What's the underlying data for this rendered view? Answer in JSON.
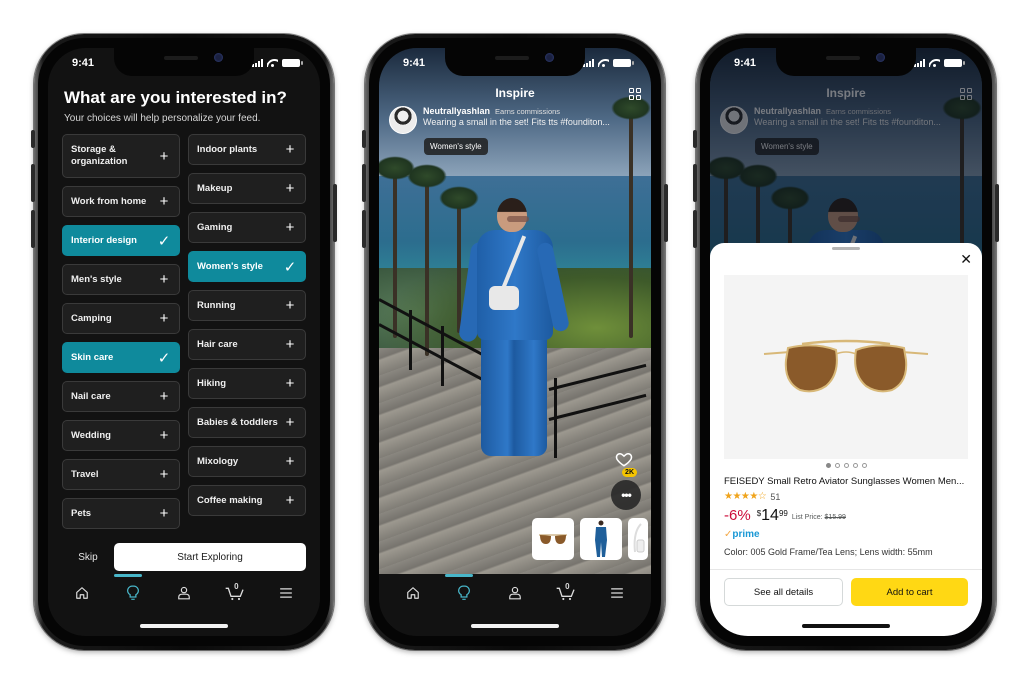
{
  "status_bar": {
    "time": "9:41"
  },
  "colors": {
    "accent_teal": "#0f8a9c",
    "nav_active": "#48b6c9",
    "add_to_cart": "#ffd814",
    "discount_red": "#cc0c39",
    "prime_blue": "#1a98d5",
    "like_badge": "#f5c400"
  },
  "nav": {
    "items": [
      {
        "name": "home",
        "icon": "home-icon",
        "active": false
      },
      {
        "name": "inspire",
        "icon": "lightbulb-icon",
        "active": true
      },
      {
        "name": "account",
        "icon": "person-icon",
        "active": false
      },
      {
        "name": "cart",
        "icon": "cart-icon",
        "active": false,
        "count": "0"
      },
      {
        "name": "menu",
        "icon": "hamburger-menu-icon",
        "active": false
      }
    ]
  },
  "onboarding": {
    "title": "What are you interested in?",
    "subtitle": "Your choices will help personalize your feed.",
    "left_column": [
      {
        "label": "Storage & organization",
        "selected": false
      },
      {
        "label": "Work from home",
        "selected": false
      },
      {
        "label": "Interior design",
        "selected": true
      },
      {
        "label": "Men's style",
        "selected": false
      },
      {
        "label": "Camping",
        "selected": false
      },
      {
        "label": "Skin care",
        "selected": true
      },
      {
        "label": "Nail care",
        "selected": false
      },
      {
        "label": "Wedding",
        "selected": false
      },
      {
        "label": "Travel",
        "selected": false
      },
      {
        "label": "Pets",
        "selected": false
      }
    ],
    "right_column": [
      {
        "label": "Indoor plants",
        "selected": false
      },
      {
        "label": "Makeup",
        "selected": false
      },
      {
        "label": "Gaming",
        "selected": false
      },
      {
        "label": "Women's style",
        "selected": true
      },
      {
        "label": "Running",
        "selected": false
      },
      {
        "label": "Hair care",
        "selected": false
      },
      {
        "label": "Hiking",
        "selected": false
      },
      {
        "label": "Babies & toddlers",
        "selected": false
      },
      {
        "label": "Mixology",
        "selected": false
      },
      {
        "label": "Coffee making",
        "selected": false
      }
    ],
    "skip_label": "Skip",
    "start_label": "Start Exploring"
  },
  "feed": {
    "title": "Inspire",
    "creator_name": "Neutrallyashlan",
    "earns_label": "Earns commissions",
    "caption": "Wearing a small in the set! Fits tts #founditon...",
    "style_tag": "Women's style",
    "like_count": "2K",
    "more_label": "•••",
    "thumbnails": [
      "sunglasses",
      "blue-jumpsuit",
      "white-bag"
    ]
  },
  "product": {
    "title": "FEISEDY Small Retro Aviator Sunglasses Women Men...",
    "rating": 4.5,
    "stars_display": "★★★★☆",
    "review_count": "51",
    "discount": "-6%",
    "price_symbol": "$",
    "price_whole": "14",
    "price_fraction": "99",
    "list_price_label": "List Price:",
    "list_price": "$15.99",
    "prime_check": "✓",
    "prime_label": "prime",
    "color_info": "Color: 005 Gold Frame/Tea Lens; Lens width: 55mm",
    "image_count": 5,
    "active_image": 1,
    "see_details_label": "See all details",
    "add_to_cart_label": "Add to cart",
    "close_label": "✕"
  }
}
